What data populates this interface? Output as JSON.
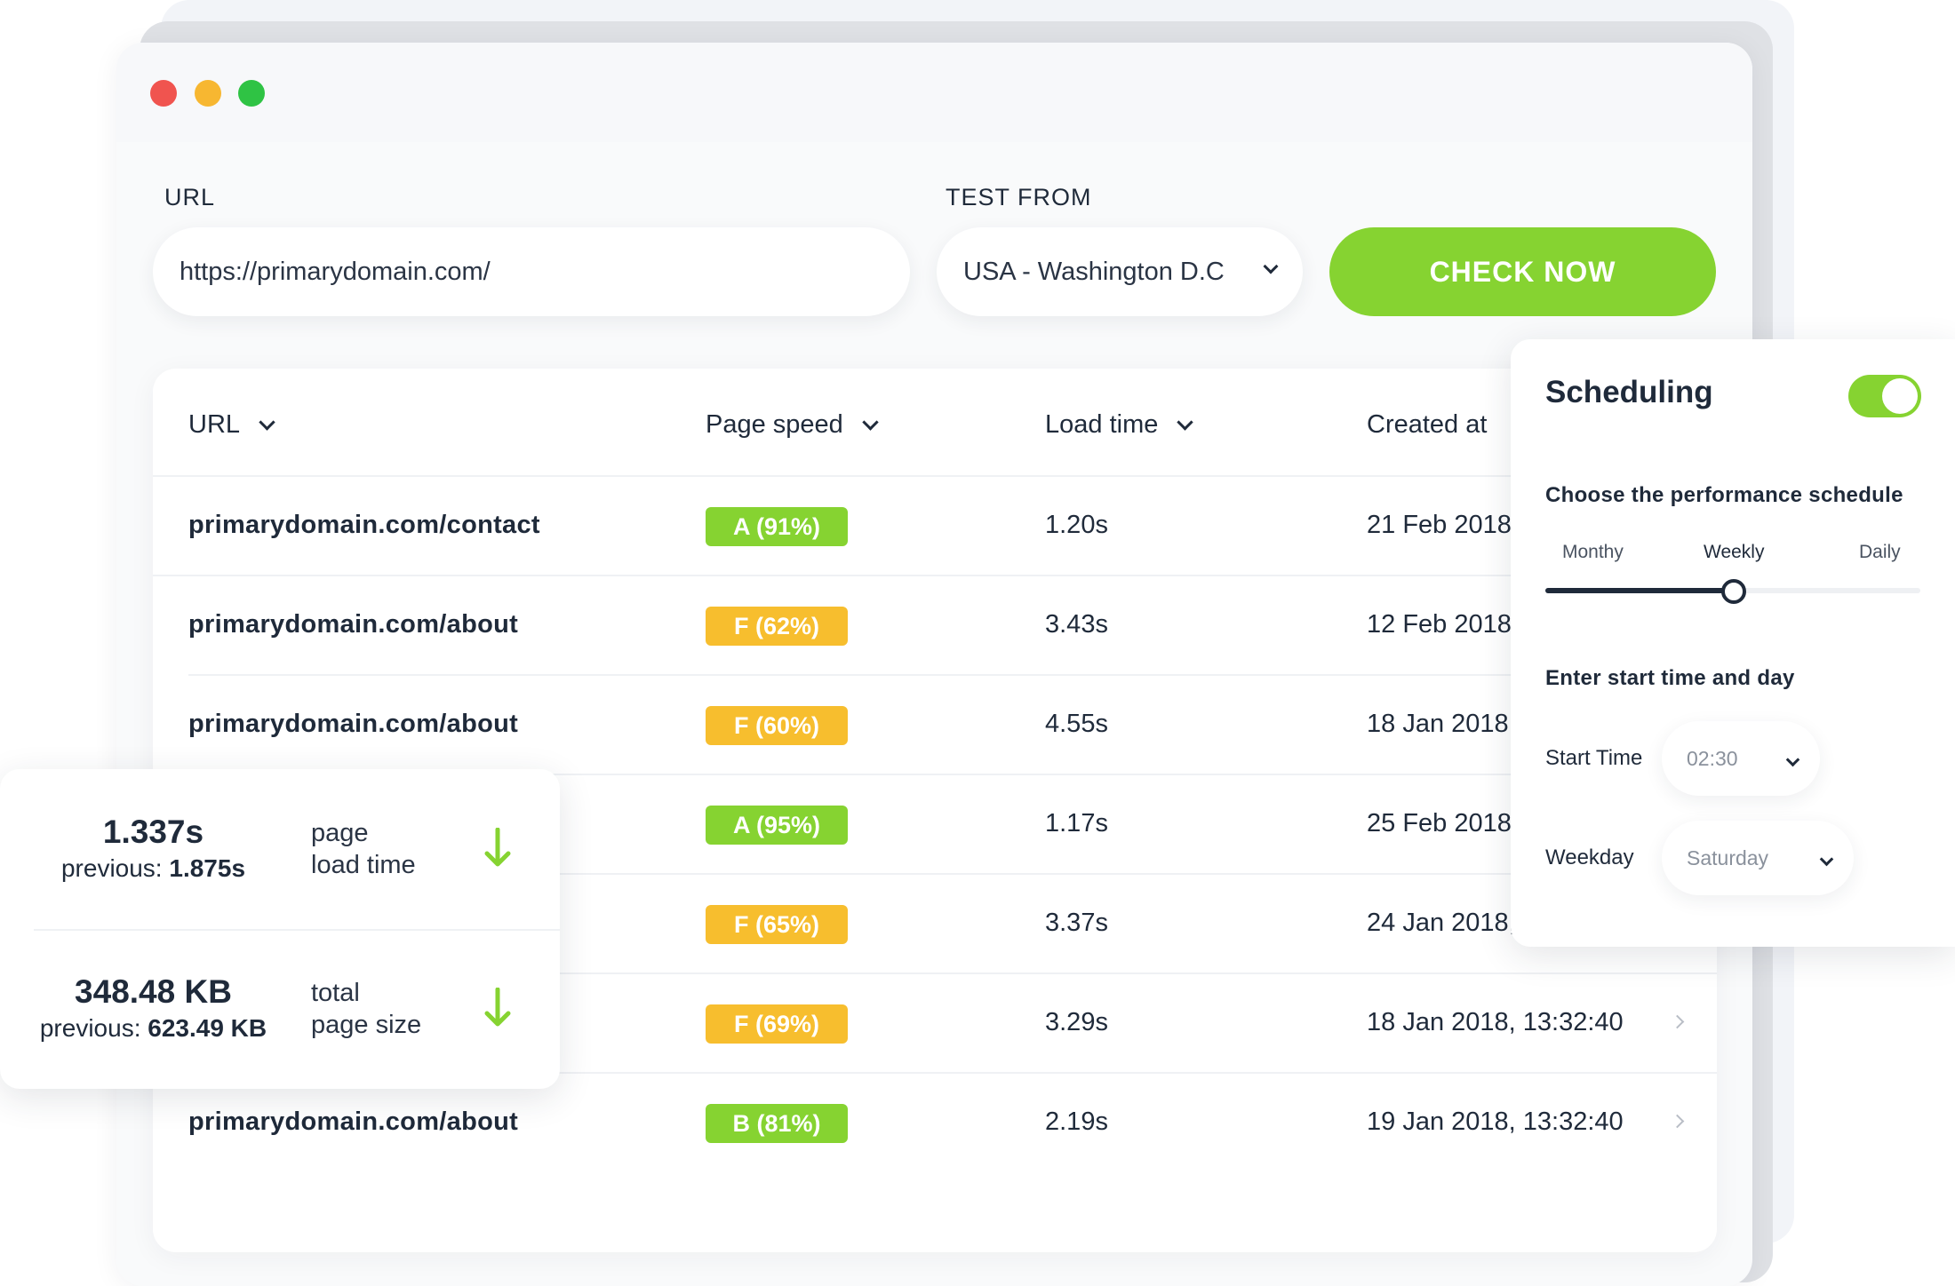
{
  "window": {
    "controls": [
      "close",
      "minimize",
      "maximize"
    ]
  },
  "form": {
    "url_label": "URL",
    "url_value": "https://primarydomain.com/",
    "test_from_label": "TEST FROM",
    "test_from_value": "USA - Washington D.C",
    "check_button": "CHECK NOW"
  },
  "table": {
    "columns": [
      "URL",
      "Page speed",
      "Load time",
      "Created at"
    ],
    "rows": [
      {
        "url": "primarydomain.com/contact",
        "grade": "A",
        "speed": "A (91%)",
        "load": "1.20s",
        "created": "21 Feb 2018"
      },
      {
        "url": "primarydomain.com/about",
        "grade": "F",
        "speed": "F (62%)",
        "load": "3.43s",
        "created": "12 Feb 2018"
      },
      {
        "url": "primarydomain.com/about",
        "grade": "F",
        "speed": "F (60%)",
        "load": "4.55s",
        "created": "18 Jan 2018,"
      },
      {
        "url": "",
        "grade": "A",
        "speed": "A (95%)",
        "load": "1.17s",
        "created": "25 Feb 2018"
      },
      {
        "url": "",
        "grade": "F",
        "speed": "F (65%)",
        "load": "3.37s",
        "created": "24 Jan 2018,"
      },
      {
        "url": "",
        "grade": "F",
        "speed": "F (69%)",
        "load": "3.29s",
        "created": "18 Jan 2018, 13:32:40"
      },
      {
        "url": "primarydomain.com/about",
        "grade": "B",
        "speed": "B (81%)",
        "load": "2.19s",
        "created": "19 Jan 2018, 13:32:40"
      }
    ]
  },
  "stats": {
    "load_time": {
      "value": "1.337s",
      "previous_label": "previous:",
      "previous": "1.875s",
      "label_line1": "page",
      "label_line2": "load time"
    },
    "page_size": {
      "value": "348.48 KB",
      "previous_label": "previous:",
      "previous": "623.49 KB",
      "label_line1": "total",
      "label_line2": "page size"
    }
  },
  "scheduling": {
    "title": "Scheduling",
    "enabled": true,
    "schedule_heading": "Choose the performance schedule",
    "options": [
      "Monthy",
      "Weekly",
      "Daily"
    ],
    "selected": "Weekly",
    "selected_fraction": 0.5,
    "time_heading": "Enter start time and day",
    "start_time_label": "Start Time",
    "start_time_value": "02:30",
    "weekday_label": "Weekday",
    "weekday_value": "Saturday"
  },
  "colors": {
    "accent_green": "#86d331",
    "warning_yellow": "#f7be2e",
    "text_dark": "#1f2a3a",
    "dot_red": "#f0544f",
    "dot_yellow": "#f7b731",
    "dot_green": "#2fc344"
  }
}
